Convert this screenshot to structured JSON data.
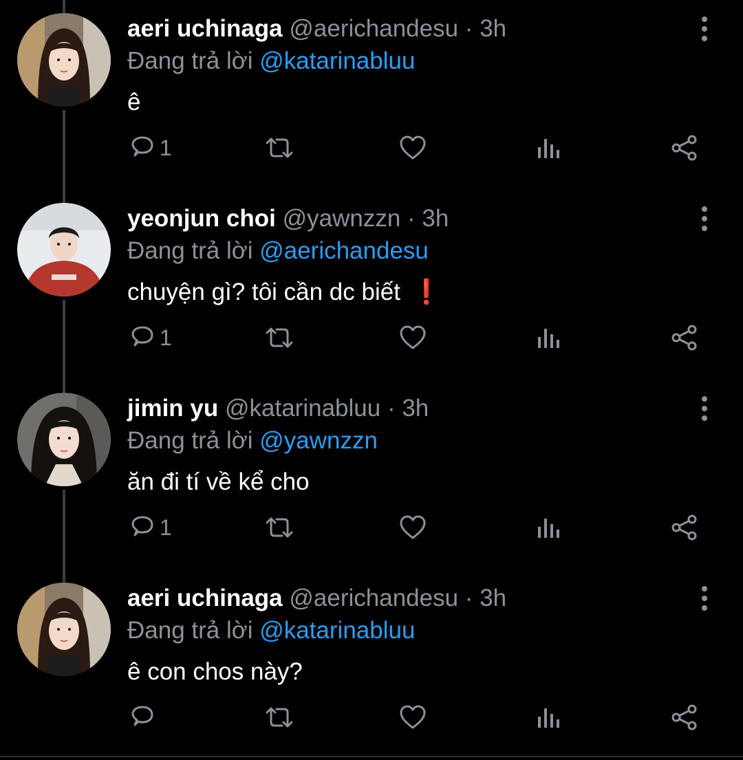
{
  "replying_label": "Đang trả lời",
  "tweets": [
    {
      "name": "aeri uchinaga",
      "handle": "@aerichandesu",
      "separator": "·",
      "time": "3h",
      "reply_to": "@katarinabluu",
      "text": "ê",
      "emoji": "",
      "reply_count": "1"
    },
    {
      "name": "yeonjun choi",
      "handle": "@yawnzzn",
      "separator": "·",
      "time": "3h",
      "reply_to": "@aerichandesu",
      "text": "chuyện gì? tôi cần dc biết",
      "emoji": "❗",
      "reply_count": "1"
    },
    {
      "name": "jimin yu",
      "handle": "@katarinabluu",
      "separator": "·",
      "time": "3h",
      "reply_to": "@yawnzzn",
      "text": "ăn đi tí về kể cho",
      "emoji": "",
      "reply_count": "1"
    },
    {
      "name": "aeri uchinaga",
      "handle": "@aerichandesu",
      "separator": "·",
      "time": "3h",
      "reply_to": "@katarinabluu",
      "text": "ê con chos này?",
      "emoji": "",
      "reply_count": ""
    }
  ],
  "icons": {
    "reply": "reply-icon",
    "retweet": "retweet-icon",
    "like": "heart-icon",
    "views": "analytics-icon",
    "share": "share-icon",
    "more": "more-vertical-icon"
  },
  "colors": {
    "background": "#000000",
    "text": "#ffffff",
    "secondary": "#8b9299",
    "link": "#2a9df4",
    "thread_line": "#3a3d41",
    "emoji_red": "#e0242b"
  }
}
